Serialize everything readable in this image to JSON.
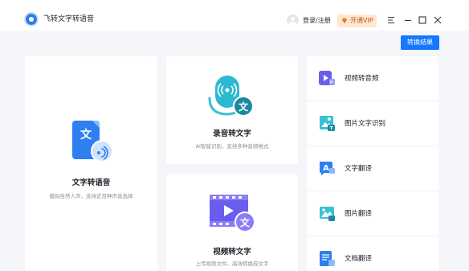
{
  "app": {
    "title": "飞转文字转语音"
  },
  "header": {
    "login_label": "登录/注册",
    "vip_label": "开通VIP",
    "result_button": "转换结果"
  },
  "colors": {
    "accent": "#1677ff",
    "vip_bg": "#ffe7cf",
    "vip_text": "#c2581a",
    "background": "#f4f6f9"
  },
  "cards": {
    "tts": {
      "title": "文字转语音",
      "desc": "模拟自然人声，支持近百种声音选择",
      "icon": "document-voice-icon"
    },
    "rec": {
      "title": "录音转文字",
      "desc": "AI智能识别，支持多种音频格式",
      "icon": "microphone-text-icon"
    },
    "vid": {
      "title": "视频转文字",
      "desc": "上传视频文件，高效转换成文字",
      "icon": "video-text-icon"
    }
  },
  "tools": [
    {
      "label": "视频转音频",
      "icon": "video-audio-icon"
    },
    {
      "label": "图片文字识别",
      "icon": "image-ocr-icon"
    },
    {
      "label": "文字翻译",
      "icon": "text-translate-icon"
    },
    {
      "label": "图片翻译",
      "icon": "image-translate-icon"
    },
    {
      "label": "文档翻译",
      "icon": "document-translate-icon"
    }
  ]
}
